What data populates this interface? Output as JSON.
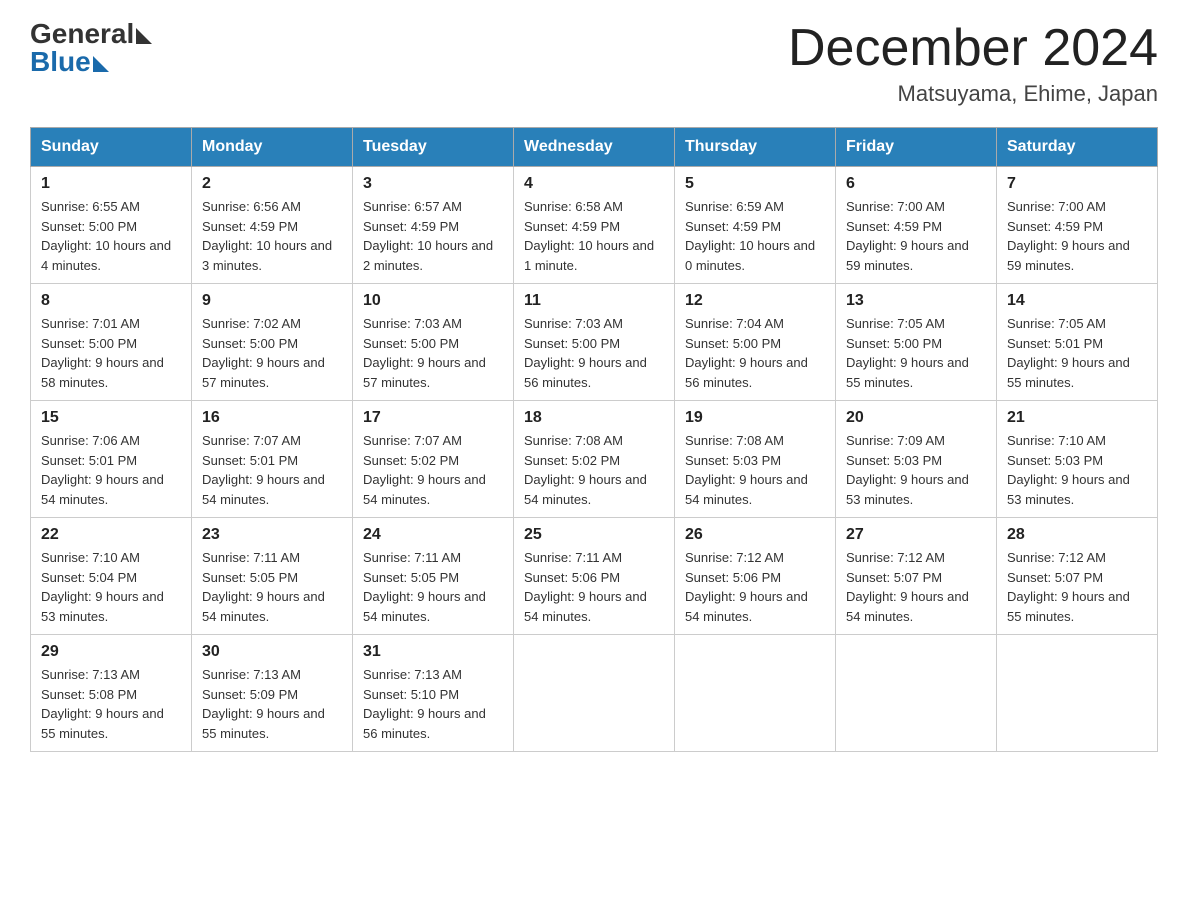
{
  "logo": {
    "general": "General",
    "blue": "Blue"
  },
  "title": "December 2024",
  "location": "Matsuyama, Ehime, Japan",
  "days_of_week": [
    "Sunday",
    "Monday",
    "Tuesday",
    "Wednesday",
    "Thursday",
    "Friday",
    "Saturday"
  ],
  "weeks": [
    [
      {
        "day": "1",
        "sunrise": "6:55 AM",
        "sunset": "5:00 PM",
        "daylight": "10 hours and 4 minutes."
      },
      {
        "day": "2",
        "sunrise": "6:56 AM",
        "sunset": "4:59 PM",
        "daylight": "10 hours and 3 minutes."
      },
      {
        "day": "3",
        "sunrise": "6:57 AM",
        "sunset": "4:59 PM",
        "daylight": "10 hours and 2 minutes."
      },
      {
        "day": "4",
        "sunrise": "6:58 AM",
        "sunset": "4:59 PM",
        "daylight": "10 hours and 1 minute."
      },
      {
        "day": "5",
        "sunrise": "6:59 AM",
        "sunset": "4:59 PM",
        "daylight": "10 hours and 0 minutes."
      },
      {
        "day": "6",
        "sunrise": "7:00 AM",
        "sunset": "4:59 PM",
        "daylight": "9 hours and 59 minutes."
      },
      {
        "day": "7",
        "sunrise": "7:00 AM",
        "sunset": "4:59 PM",
        "daylight": "9 hours and 59 minutes."
      }
    ],
    [
      {
        "day": "8",
        "sunrise": "7:01 AM",
        "sunset": "5:00 PM",
        "daylight": "9 hours and 58 minutes."
      },
      {
        "day": "9",
        "sunrise": "7:02 AM",
        "sunset": "5:00 PM",
        "daylight": "9 hours and 57 minutes."
      },
      {
        "day": "10",
        "sunrise": "7:03 AM",
        "sunset": "5:00 PM",
        "daylight": "9 hours and 57 minutes."
      },
      {
        "day": "11",
        "sunrise": "7:03 AM",
        "sunset": "5:00 PM",
        "daylight": "9 hours and 56 minutes."
      },
      {
        "day": "12",
        "sunrise": "7:04 AM",
        "sunset": "5:00 PM",
        "daylight": "9 hours and 56 minutes."
      },
      {
        "day": "13",
        "sunrise": "7:05 AM",
        "sunset": "5:00 PM",
        "daylight": "9 hours and 55 minutes."
      },
      {
        "day": "14",
        "sunrise": "7:05 AM",
        "sunset": "5:01 PM",
        "daylight": "9 hours and 55 minutes."
      }
    ],
    [
      {
        "day": "15",
        "sunrise": "7:06 AM",
        "sunset": "5:01 PM",
        "daylight": "9 hours and 54 minutes."
      },
      {
        "day": "16",
        "sunrise": "7:07 AM",
        "sunset": "5:01 PM",
        "daylight": "9 hours and 54 minutes."
      },
      {
        "day": "17",
        "sunrise": "7:07 AM",
        "sunset": "5:02 PM",
        "daylight": "9 hours and 54 minutes."
      },
      {
        "day": "18",
        "sunrise": "7:08 AM",
        "sunset": "5:02 PM",
        "daylight": "9 hours and 54 minutes."
      },
      {
        "day": "19",
        "sunrise": "7:08 AM",
        "sunset": "5:03 PM",
        "daylight": "9 hours and 54 minutes."
      },
      {
        "day": "20",
        "sunrise": "7:09 AM",
        "sunset": "5:03 PM",
        "daylight": "9 hours and 53 minutes."
      },
      {
        "day": "21",
        "sunrise": "7:10 AM",
        "sunset": "5:03 PM",
        "daylight": "9 hours and 53 minutes."
      }
    ],
    [
      {
        "day": "22",
        "sunrise": "7:10 AM",
        "sunset": "5:04 PM",
        "daylight": "9 hours and 53 minutes."
      },
      {
        "day": "23",
        "sunrise": "7:11 AM",
        "sunset": "5:05 PM",
        "daylight": "9 hours and 54 minutes."
      },
      {
        "day": "24",
        "sunrise": "7:11 AM",
        "sunset": "5:05 PM",
        "daylight": "9 hours and 54 minutes."
      },
      {
        "day": "25",
        "sunrise": "7:11 AM",
        "sunset": "5:06 PM",
        "daylight": "9 hours and 54 minutes."
      },
      {
        "day": "26",
        "sunrise": "7:12 AM",
        "sunset": "5:06 PM",
        "daylight": "9 hours and 54 minutes."
      },
      {
        "day": "27",
        "sunrise": "7:12 AM",
        "sunset": "5:07 PM",
        "daylight": "9 hours and 54 minutes."
      },
      {
        "day": "28",
        "sunrise": "7:12 AM",
        "sunset": "5:07 PM",
        "daylight": "9 hours and 55 minutes."
      }
    ],
    [
      {
        "day": "29",
        "sunrise": "7:13 AM",
        "sunset": "5:08 PM",
        "daylight": "9 hours and 55 minutes."
      },
      {
        "day": "30",
        "sunrise": "7:13 AM",
        "sunset": "5:09 PM",
        "daylight": "9 hours and 55 minutes."
      },
      {
        "day": "31",
        "sunrise": "7:13 AM",
        "sunset": "5:10 PM",
        "daylight": "9 hours and 56 minutes."
      },
      null,
      null,
      null,
      null
    ]
  ]
}
